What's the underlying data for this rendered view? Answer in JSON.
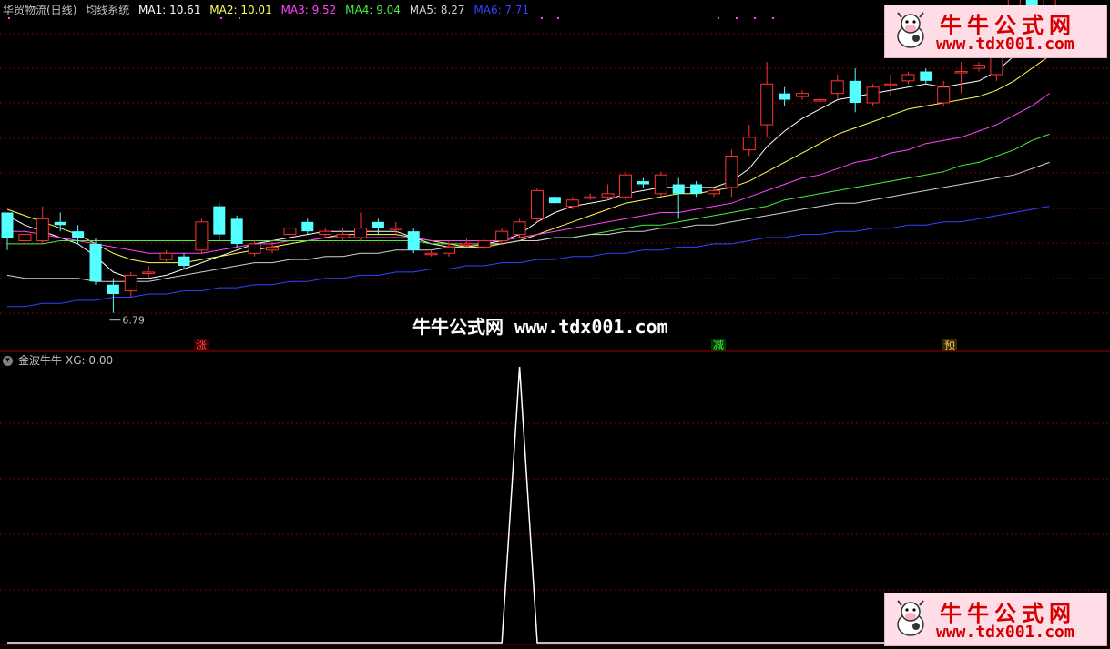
{
  "upper_header": {
    "stock": "华贸物流(日线)",
    "indicator": "均线系统",
    "ma": [
      {
        "label": "MA1: 10.61",
        "color": "#ffffff"
      },
      {
        "label": "MA2: 10.01",
        "color": "#ffff55"
      },
      {
        "label": "MA3: 9.52",
        "color": "#ff44ff"
      },
      {
        "label": "MA4: 9.04",
        "color": "#44ee44"
      },
      {
        "label": "MA5: 8.27",
        "color": "#d0d0d0"
      },
      {
        "label": "MA6: 7.71",
        "color": "#3344ff"
      }
    ]
  },
  "lower_header": {
    "indicator": "金波牛牛",
    "value": "XG: 0.00"
  },
  "watermark": "牛牛公式网 www.tdx001.com",
  "logo": {
    "title": "牛牛公式网",
    "url": "www.tdx001.com"
  },
  "signals": [
    {
      "text": "涨",
      "color": "#ff4444"
    },
    {
      "text": "减",
      "color": "#44ee44"
    },
    {
      "text": "预",
      "color": "#ffcc66"
    }
  ],
  "low_label": "6.79",
  "colors": {
    "up": "#ff3232",
    "down": "#54ffff",
    "grid": "#800000"
  },
  "chart_data": [
    {
      "type": "candlestick",
      "title": "华贸物流(日线)",
      "ylim": [
        6.3,
        11.6
      ],
      "candles": [
        [
          8.5,
          8.1,
          8.5,
          7.9
        ],
        [
          8.05,
          8.15,
          8.3,
          8.0
        ],
        [
          8.05,
          8.4,
          8.6,
          8.0
        ],
        [
          8.35,
          8.3,
          8.5,
          8.2
        ],
        [
          8.2,
          8.1,
          8.3,
          8.0
        ],
        [
          8.0,
          7.4,
          8.1,
          7.35
        ],
        [
          7.35,
          7.2,
          7.45,
          6.9
        ],
        [
          7.25,
          7.5,
          7.55,
          7.15
        ],
        [
          7.55,
          7.55,
          7.65,
          7.45
        ],
        [
          7.75,
          7.85,
          7.9,
          7.7
        ],
        [
          7.8,
          7.65,
          7.85,
          7.6
        ],
        [
          7.9,
          8.35,
          8.4,
          7.85
        ],
        [
          8.6,
          8.15,
          8.65,
          8.05
        ],
        [
          8.4,
          8.0,
          8.45,
          7.95
        ],
        [
          7.85,
          8.0,
          8.05,
          7.8
        ],
        [
          7.9,
          7.95,
          8.05,
          7.85
        ],
        [
          8.15,
          8.25,
          8.4,
          8.05
        ],
        [
          8.35,
          8.2,
          8.4,
          8.15
        ],
        [
          8.15,
          8.2,
          8.25,
          8.1
        ],
        [
          8.1,
          8.15,
          8.25,
          8.05
        ],
        [
          8.1,
          8.25,
          8.5,
          8.05
        ],
        [
          8.35,
          8.25,
          8.4,
          8.15
        ],
        [
          8.25,
          8.25,
          8.35,
          8.15
        ],
        [
          8.2,
          7.9,
          8.25,
          7.85
        ],
        [
          7.85,
          7.85,
          7.9,
          7.8
        ],
        [
          7.85,
          7.95,
          8.05,
          7.8
        ],
        [
          8.0,
          8.0,
          8.1,
          7.95
        ],
        [
          7.95,
          8.05,
          8.1,
          7.9
        ],
        [
          8.05,
          8.2,
          8.25,
          8.0
        ],
        [
          8.15,
          8.35,
          8.4,
          8.1
        ],
        [
          8.4,
          8.85,
          8.9,
          8.35
        ],
        [
          8.75,
          8.65,
          8.8,
          8.6
        ],
        [
          8.6,
          8.7,
          8.75,
          8.55
        ],
        [
          8.75,
          8.75,
          8.8,
          8.7
        ],
        [
          8.75,
          8.8,
          8.95,
          8.7
        ],
        [
          8.75,
          9.1,
          9.15,
          8.7
        ],
        [
          9.0,
          8.95,
          9.05,
          8.9
        ],
        [
          8.8,
          9.1,
          9.15,
          8.75
        ],
        [
          8.95,
          8.8,
          9.05,
          8.4
        ],
        [
          8.95,
          8.8,
          9.0,
          8.75
        ],
        [
          8.8,
          8.85,
          8.9,
          8.75
        ],
        [
          8.9,
          9.4,
          9.5,
          8.75
        ],
        [
          9.5,
          9.7,
          9.9,
          9.4
        ],
        [
          9.9,
          10.55,
          10.9,
          9.7
        ],
        [
          10.4,
          10.3,
          10.5,
          10.2
        ],
        [
          10.35,
          10.4,
          10.45,
          10.3
        ],
        [
          10.3,
          10.3,
          10.35,
          10.15
        ],
        [
          10.4,
          10.6,
          10.7,
          10.3
        ],
        [
          10.6,
          10.25,
          10.8,
          10.1
        ],
        [
          10.25,
          10.5,
          10.55,
          10.2
        ],
        [
          10.55,
          10.55,
          10.7,
          10.35
        ],
        [
          10.6,
          10.7,
          10.75,
          10.55
        ],
        [
          10.75,
          10.6,
          10.8,
          10.55
        ],
        [
          10.25,
          10.5,
          10.6,
          10.2
        ],
        [
          10.75,
          10.75,
          10.9,
          10.4
        ],
        [
          10.8,
          10.85,
          10.9,
          10.75
        ],
        [
          10.7,
          11.35,
          11.6,
          10.6
        ],
        [
          11.3,
          12.4,
          12.9,
          11.2
        ],
        [
          12.1,
          11.55,
          12.5,
          11.2
        ],
        [
          11.35,
          12.2,
          12.6,
          11.2
        ]
      ],
      "series": [
        {
          "name": "MA1",
          "values": [
            8.45,
            8.3,
            8.2,
            8.1,
            8.0,
            7.8,
            7.55,
            7.45,
            7.45,
            7.5,
            7.6,
            7.7,
            7.8,
            7.9,
            8.0,
            8.05,
            8.1,
            8.15,
            8.2,
            8.2,
            8.2,
            8.2,
            8.2,
            8.1,
            8.0,
            7.95,
            7.95,
            8.0,
            8.05,
            8.15,
            8.35,
            8.5,
            8.6,
            8.65,
            8.7,
            8.8,
            8.85,
            8.9,
            8.9,
            8.9,
            8.9,
            9.0,
            9.2,
            9.55,
            9.8,
            10.0,
            10.15,
            10.3,
            10.35,
            10.4,
            10.45,
            10.5,
            10.55,
            10.5,
            10.55,
            10.6,
            10.75,
            11.0,
            11.2,
            11.4
          ]
        },
        {
          "name": "MA2",
          "values": [
            8.55,
            8.45,
            8.35,
            8.25,
            8.15,
            8.0,
            7.85,
            7.75,
            7.7,
            7.7,
            7.7,
            7.75,
            7.8,
            7.85,
            7.9,
            7.95,
            8.0,
            8.05,
            8.1,
            8.15,
            8.15,
            8.15,
            8.15,
            8.1,
            8.05,
            8.0,
            7.95,
            7.95,
            8.0,
            8.05,
            8.15,
            8.25,
            8.35,
            8.45,
            8.55,
            8.65,
            8.7,
            8.75,
            8.8,
            8.8,
            8.85,
            8.9,
            9.0,
            9.15,
            9.3,
            9.45,
            9.6,
            9.75,
            9.85,
            9.95,
            10.05,
            10.15,
            10.2,
            10.25,
            10.3,
            10.35,
            10.45,
            10.6,
            10.8,
            11.0
          ]
        },
        {
          "name": "MA3",
          "values": [
            8.2,
            8.2,
            8.15,
            8.1,
            8.05,
            8.0,
            7.95,
            7.9,
            7.85,
            7.85,
            7.85,
            7.85,
            7.9,
            7.95,
            8.0,
            8.0,
            8.05,
            8.05,
            8.1,
            8.1,
            8.1,
            8.1,
            8.1,
            8.1,
            8.05,
            8.05,
            8.05,
            8.05,
            8.05,
            8.1,
            8.15,
            8.2,
            8.25,
            8.3,
            8.35,
            8.4,
            8.45,
            8.5,
            8.5,
            8.55,
            8.6,
            8.65,
            8.75,
            8.85,
            8.95,
            9.05,
            9.1,
            9.2,
            9.3,
            9.35,
            9.45,
            9.5,
            9.6,
            9.65,
            9.7,
            9.8,
            9.9,
            10.05,
            10.2,
            10.4
          ]
        },
        {
          "name": "MA4",
          "values": [
            8.0,
            8.0,
            8.0,
            8.05,
            8.05,
            8.05,
            8.05,
            8.05,
            8.05,
            8.05,
            8.05,
            8.05,
            8.05,
            8.05,
            8.05,
            8.05,
            8.05,
            8.05,
            8.05,
            8.05,
            8.05,
            8.05,
            8.05,
            8.05,
            8.0,
            8.0,
            8.0,
            8.0,
            8.0,
            8.05,
            8.05,
            8.1,
            8.1,
            8.15,
            8.2,
            8.25,
            8.3,
            8.3,
            8.35,
            8.4,
            8.45,
            8.5,
            8.55,
            8.6,
            8.7,
            8.75,
            8.8,
            8.85,
            8.9,
            8.95,
            9.0,
            9.05,
            9.1,
            9.15,
            9.25,
            9.3,
            9.4,
            9.5,
            9.65,
            9.75
          ]
        },
        {
          "name": "MA5",
          "values": [
            7.5,
            7.45,
            7.45,
            7.45,
            7.45,
            7.4,
            7.4,
            7.4,
            7.4,
            7.45,
            7.5,
            7.55,
            7.6,
            7.65,
            7.7,
            7.7,
            7.75,
            7.75,
            7.8,
            7.8,
            7.85,
            7.85,
            7.9,
            7.9,
            7.9,
            7.95,
            7.95,
            8.0,
            8.0,
            8.05,
            8.05,
            8.1,
            8.1,
            8.15,
            8.15,
            8.2,
            8.2,
            8.25,
            8.25,
            8.3,
            8.3,
            8.35,
            8.4,
            8.45,
            8.5,
            8.55,
            8.6,
            8.65,
            8.65,
            8.7,
            8.75,
            8.8,
            8.85,
            8.9,
            8.95,
            9.0,
            9.05,
            9.1,
            9.2,
            9.3
          ]
        },
        {
          "name": "MA6",
          "values": [
            7.0,
            7.0,
            7.05,
            7.05,
            7.1,
            7.1,
            7.15,
            7.15,
            7.2,
            7.2,
            7.25,
            7.25,
            7.3,
            7.3,
            7.35,
            7.35,
            7.4,
            7.4,
            7.45,
            7.45,
            7.5,
            7.5,
            7.55,
            7.55,
            7.6,
            7.6,
            7.65,
            7.65,
            7.7,
            7.7,
            7.75,
            7.75,
            7.8,
            7.8,
            7.85,
            7.85,
            7.9,
            7.9,
            7.95,
            7.95,
            8.0,
            8.0,
            8.05,
            8.1,
            8.1,
            8.15,
            8.15,
            8.2,
            8.2,
            8.25,
            8.25,
            8.3,
            8.3,
            8.35,
            8.35,
            8.4,
            8.45,
            8.5,
            8.55,
            8.6
          ]
        }
      ]
    },
    {
      "type": "line",
      "title": "金波牛牛",
      "ylim": [
        0,
        1
      ],
      "series": [
        {
          "name": "XG",
          "values": [
            0,
            0,
            0,
            0,
            0,
            0,
            0,
            0,
            0,
            0,
            0,
            0,
            0,
            0,
            0,
            0,
            0,
            0,
            0,
            0,
            0,
            0,
            0,
            0,
            0,
            0,
            0,
            0,
            0,
            1,
            0,
            0,
            0,
            0,
            0,
            0,
            0,
            0,
            0,
            0,
            0,
            0,
            0,
            0,
            0,
            0,
            0,
            0,
            0,
            0,
            0,
            0,
            0,
            0,
            0,
            0,
            0,
            0,
            0,
            0
          ]
        }
      ]
    }
  ]
}
